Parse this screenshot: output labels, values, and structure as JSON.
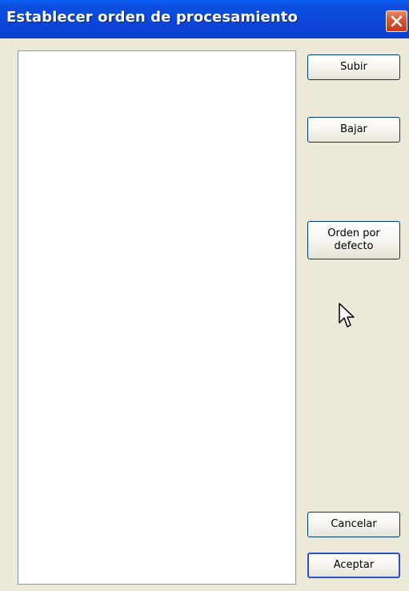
{
  "window": {
    "title": "Establecer orden de procesamiento",
    "close_icon": "close-icon"
  },
  "list": {
    "items": []
  },
  "buttons": {
    "up_label": "Subir",
    "down_label": "Bajar",
    "default_order_line1": "Orden por",
    "default_order_line2": "defecto",
    "cancel_label": "Cancelar",
    "accept_label": "Aceptar"
  },
  "colors": {
    "titlebar": "#0c45d8",
    "close_button": "#d9562f",
    "face": "#ece9d8",
    "button_border": "#003c74"
  }
}
